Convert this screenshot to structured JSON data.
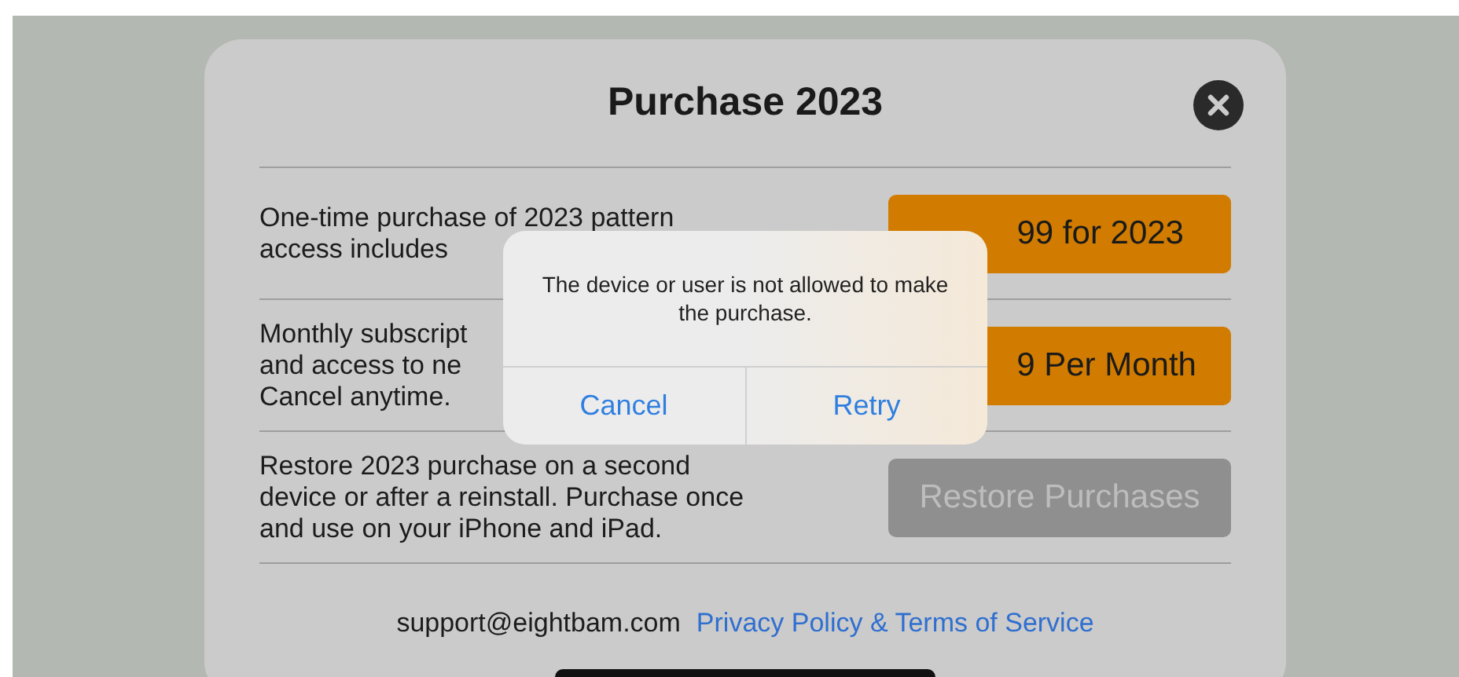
{
  "sheet": {
    "title": "Purchase 2023",
    "options": [
      {
        "lines": [
          "One-time purchase of 2023 pattern",
          "access includes"
        ],
        "button": {
          "label": "99 for 2023",
          "disabled": false
        }
      },
      {
        "lines": [
          "Monthly subscript",
          "and access to ne",
          "Cancel anytime."
        ],
        "button": {
          "label": "9 Per Month",
          "disabled": false
        }
      },
      {
        "lines": [
          "Restore 2023 purchase on a second",
          "device or after a reinstall. Purchase once",
          "and use on your iPhone and iPad."
        ],
        "button": {
          "label": "Restore Purchases",
          "disabled": true
        }
      }
    ],
    "footer": {
      "email": "support@eightbam.com",
      "link": "Privacy Policy & Terms of Service"
    }
  },
  "alert": {
    "message": "The device or user is not allowed to make the purchase.",
    "buttons": [
      "Cancel",
      "Retry"
    ]
  }
}
